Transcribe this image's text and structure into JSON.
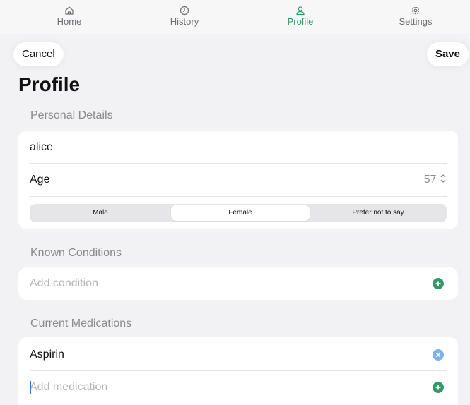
{
  "tabs": [
    {
      "label": "Home",
      "icon": "home-icon"
    },
    {
      "label": "History",
      "icon": "clock-icon"
    },
    {
      "label": "Profile",
      "icon": "person-icon",
      "active": true
    },
    {
      "label": "Settings",
      "icon": "gear-icon"
    }
  ],
  "toolbar": {
    "cancel_label": "Cancel",
    "save_label": "Save"
  },
  "page": {
    "title": "Profile"
  },
  "personal": {
    "section_label": "Personal Details",
    "name_value": "alice",
    "age_label": "Age",
    "age_value": "57",
    "stepper_icon": "up-down-chevron-icon",
    "gender_options": [
      "Male",
      "Female",
      "Prefer not to say"
    ],
    "gender_selected": "Female"
  },
  "conditions": {
    "section_label": "Known Conditions",
    "add_placeholder": "Add condition",
    "add_icon": "plus-circle-icon"
  },
  "medications": {
    "section_label": "Current Medications",
    "items": [
      {
        "name": "Aspirin",
        "remove_icon": "x-circle-icon"
      }
    ],
    "add_placeholder": "Add medication",
    "add_icon": "plus-circle-icon"
  },
  "colors": {
    "accent_green": "#2e9a6a",
    "remove_blue": "#7fb2ec",
    "background": "#f2f2f4",
    "card": "#ffffff"
  }
}
